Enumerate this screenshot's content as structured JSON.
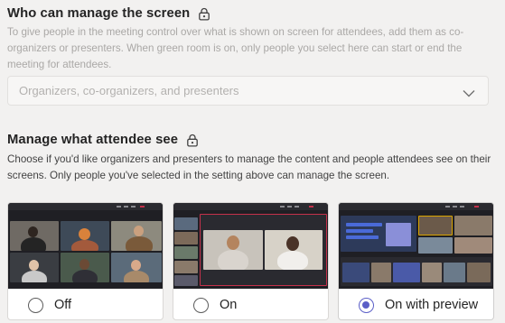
{
  "section1": {
    "title": "Who can manage the screen",
    "description": "To give people in the meeting control over what is shown on screen for attendees, add them as co-organizers or presenters. When green room is on, only people you select here can start or end the meeting for attendees.",
    "dropdown": {
      "value": "Organizers, co-organizers, and presenters"
    }
  },
  "section2": {
    "title": "Manage what attendee see",
    "description": "Choose if you'd like organizers and presenters to manage the content and people attendees see on their screens. Only people you've selected in the setting above can manage the screen.",
    "options": [
      {
        "label": "Off",
        "selected": false
      },
      {
        "label": "On",
        "selected": false
      },
      {
        "label": "On with preview",
        "selected": true
      }
    ]
  },
  "icons": {
    "lock": "lock-icon",
    "dropdown_chevron": "chevron-down-icon"
  },
  "colors": {
    "radio_selected": "#5b5fc7",
    "live_highlight": "#c4314b",
    "thumbnail_bg": "#1f1f24"
  }
}
